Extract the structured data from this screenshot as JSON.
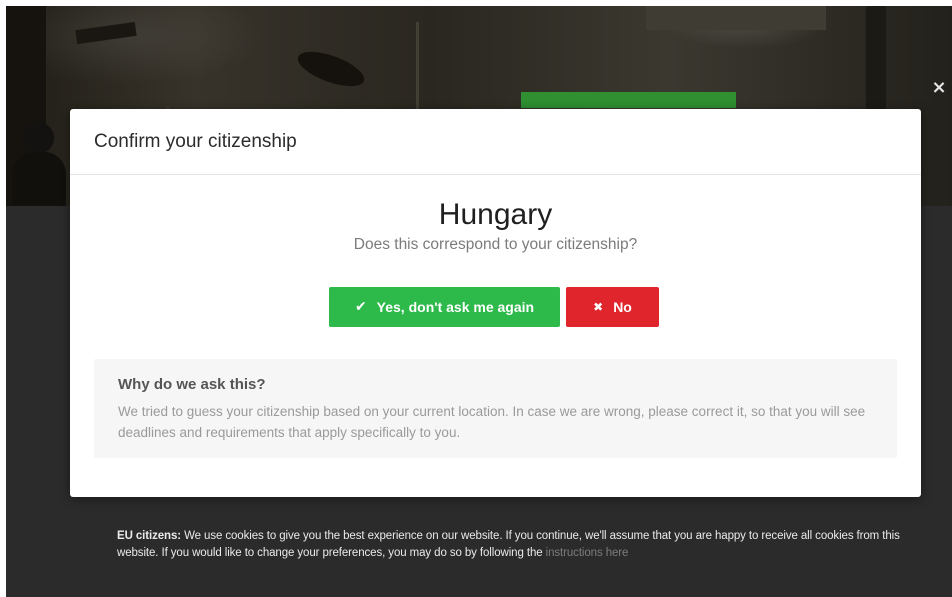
{
  "overlay": {
    "close_icon": "×"
  },
  "modal": {
    "title": "Confirm your citizenship",
    "country": "Hungary",
    "question": "Does this correspond to your citizenship?",
    "yes_button": {
      "icon": "check-icon",
      "icon_glyph": "✔",
      "label": "Yes, don't ask me again",
      "color": "#2eb94b"
    },
    "no_button": {
      "icon": "x-icon",
      "icon_glyph": "✖",
      "label": "No",
      "color": "#e0262c"
    },
    "info": {
      "heading": "Why do we ask this?",
      "text": "We tried to guess your citizenship based on your current location. In case we are wrong, please correct it, so that you will see deadlines and requirements that apply specifically to you."
    }
  },
  "cookie_notice": {
    "label": "EU citizens:",
    "text": " We use cookies to give you the best experience on our website. If you continue, we'll assume that you are happy to receive all cookies from this website. If you would like to change your preferences, you may do so by following the ",
    "link_text": "instructions here"
  }
}
